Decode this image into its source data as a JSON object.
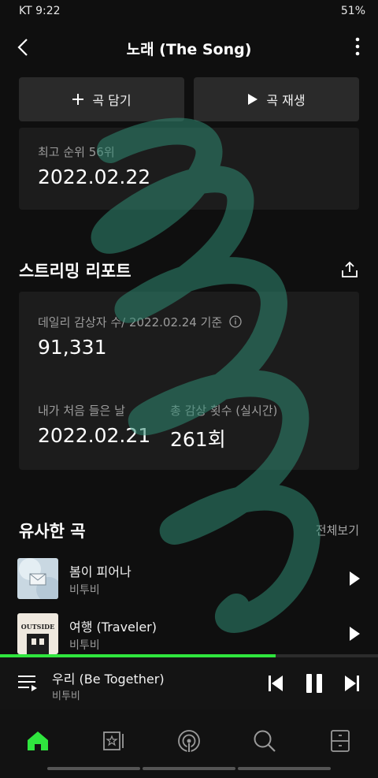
{
  "status_bar": {
    "left": "KT 9:22",
    "right": "51%"
  },
  "header": {
    "title": "노래 (The Song)"
  },
  "actions": {
    "add_label": "곡 담기",
    "play_label": "곡 재생"
  },
  "chart_card": {
    "peak_label": "최고 순위 56위",
    "peak_date": "2022.02.22"
  },
  "streaming_report": {
    "title": "스트리밍 리포트",
    "daily_label": "데일리 감상자 수/ 2022.02.24 기준",
    "daily_value": "91,331",
    "first_listen_label": "내가 처음 들은 날",
    "first_listen_value": "2022.02.21",
    "total_plays_label": "총 감상 횟수 (실시간)",
    "total_plays_value": "261회"
  },
  "similar": {
    "title": "유사한 곡",
    "view_all": "전체보기",
    "songs": [
      {
        "title": "봄이 피어나",
        "artist": "비투비"
      },
      {
        "title": "여행 (Traveler)",
        "artist": "비투비",
        "art_text": "OUTSIDE"
      }
    ]
  },
  "now_playing": {
    "title": "우리 (Be Together)",
    "artist": "비투비",
    "progress": 0.73
  },
  "colors": {
    "accent": "#2fe53e",
    "watermark": "#2f8a72"
  }
}
